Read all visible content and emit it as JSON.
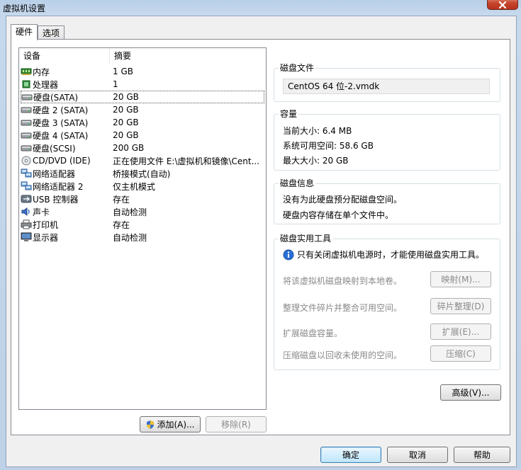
{
  "window": {
    "title": "虚拟机设置"
  },
  "tabs": [
    {
      "label": "硬件"
    },
    {
      "label": "选项"
    }
  ],
  "device_list": {
    "headers": {
      "device": "设备",
      "summary": "摘要"
    },
    "items": [
      {
        "icon": "memory-icon",
        "device": "内存",
        "summary": "1 GB"
      },
      {
        "icon": "processor-icon",
        "device": "处理器",
        "summary": "1"
      },
      {
        "icon": "hard-disk-icon",
        "device": "硬盘(SATA)",
        "summary": "20 GB",
        "selected": true
      },
      {
        "icon": "hard-disk-icon",
        "device": "硬盘 2 (SATA)",
        "summary": "20 GB"
      },
      {
        "icon": "hard-disk-icon",
        "device": "硬盘 3 (SATA)",
        "summary": "20 GB"
      },
      {
        "icon": "hard-disk-icon",
        "device": "硬盘 4 (SATA)",
        "summary": "20 GB"
      },
      {
        "icon": "hard-disk-icon",
        "device": "硬盘(SCSI)",
        "summary": "200 GB"
      },
      {
        "icon": "cd-dvd-icon",
        "device": "CD/DVD (IDE)",
        "summary": "正在使用文件 E:\\虚拟机和镜像\\Cent..."
      },
      {
        "icon": "network-adapter-icon",
        "device": "网络适配器",
        "summary": "桥接模式(自动)"
      },
      {
        "icon": "network-adapter-icon",
        "device": "网络适配器 2",
        "summary": "仅主机模式"
      },
      {
        "icon": "usb-controller-icon",
        "device": "USB 控制器",
        "summary": "存在"
      },
      {
        "icon": "sound-card-icon",
        "device": "声卡",
        "summary": "自动检测"
      },
      {
        "icon": "printer-icon",
        "device": "打印机",
        "summary": "存在"
      },
      {
        "icon": "display-icon",
        "device": "显示器",
        "summary": "自动检测"
      }
    ]
  },
  "list_buttons": {
    "add": "添加(A)...",
    "remove": "移除(R)"
  },
  "disk_file": {
    "title": "磁盘文件",
    "value": "CentOS 64 位-2.vmdk"
  },
  "capacity": {
    "title": "容量",
    "current_size": "当前大小: 6.4 MB",
    "free_space": "系统可用空间: 58.6 GB",
    "max_size": "最大大小: 20 GB"
  },
  "disk_info": {
    "title": "磁盘信息",
    "line1": "没有为此硬盘预分配磁盘空间。",
    "line2": "硬盘内容存储在单个文件中。"
  },
  "disk_utilities": {
    "title": "磁盘实用工具",
    "notice": "只有关闭虚拟机电源时，才能使用磁盘实用工具。",
    "map_text": "将该虚拟机磁盘映射到本地卷。",
    "map_button": "映射(M)...",
    "defrag_text": "整理文件碎片并整合可用空间。",
    "defrag_button": "碎片整理(D)",
    "expand_text": "扩展磁盘容量。",
    "expand_button": "扩展(E)...",
    "compact_text": "压缩磁盘以回收未使用的空间。",
    "compact_button": "压缩(C)"
  },
  "advanced_button": "高级(V)...",
  "dialog_buttons": {
    "ok": "确定",
    "cancel": "取消",
    "help": "帮助"
  }
}
